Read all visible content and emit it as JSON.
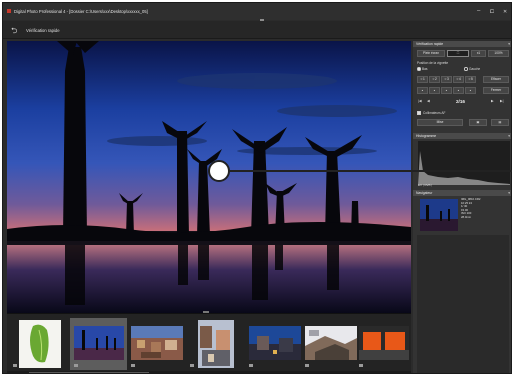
{
  "window": {
    "title": "Digital Photo Professional 4 - [Dossier C:\\Users\\xxx\\Desktop\\xxxxxx_05]",
    "controls": [
      "–",
      "⧠",
      "✕"
    ]
  },
  "toolbar": {
    "back_icon": "back-arrow-icon",
    "label": "Vérification rapide"
  },
  "quickcheck_panel": {
    "header": "Vérification rapide",
    "fit_label": "Plein écran",
    "zoom_1_label": "x1",
    "zoom_percent": "100%",
    "af_position_label": "Position de la vignette",
    "radio_top": "Bas",
    "radio_left": "Gauche",
    "ratings": [
      "☆1",
      "☆2",
      "☆3",
      "☆4",
      "☆5"
    ],
    "clear_label": "Effacer",
    "dots": [
      "●",
      "●",
      "●",
      "●",
      "●"
    ],
    "close_label": "Fermer",
    "page_counter": "2/16",
    "af_check_label": "Collimateurs AF",
    "menu_label": "Mise"
  },
  "histogram_panel": {
    "header": "Histogramme",
    "tabs": [
      "RVB",
      "Lum",
      "R",
      "V",
      "B"
    ],
    "tab_row": "EV | RVB |"
  },
  "navigator_panel": {
    "header": "Navigateur",
    "info": [
      "IMG_0810.CR2",
      "10:25 24",
      "1/ 30",
      "f/4.00",
      "ISO 100",
      "28.0mm"
    ]
  },
  "colors": {
    "accent_selected": "#5d5d5d",
    "window_bg": "#2b2b2b",
    "panel_header": "#4a4a4a"
  }
}
